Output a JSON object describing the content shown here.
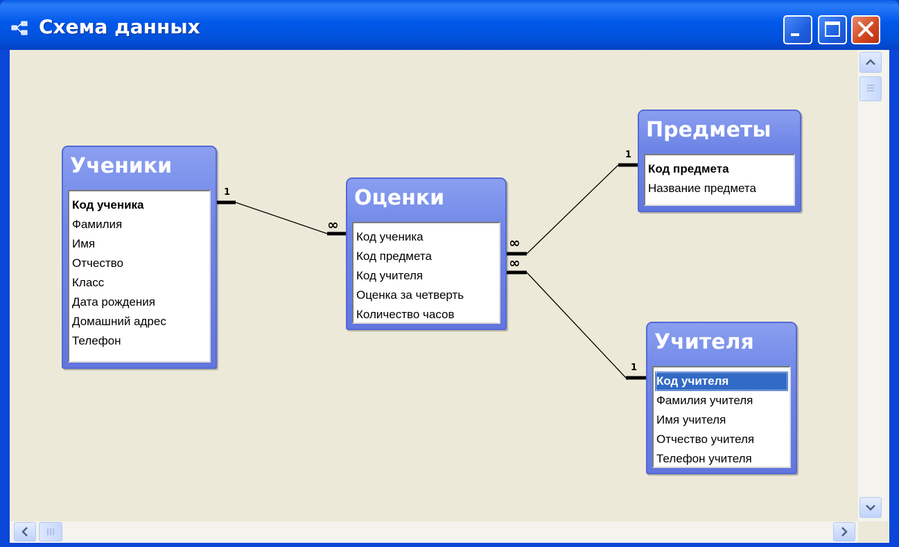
{
  "window": {
    "title": "Схема данных"
  },
  "titlebar_buttons": {
    "minimize": "minimize-icon",
    "maximize": "maximize-icon",
    "close": "close-icon"
  },
  "tables": {
    "students": {
      "title": "Ученики",
      "fields": [
        "Код ученика",
        "Фамилия",
        "Имя",
        "Отчество",
        "Класс",
        "Дата рождения",
        "Домашний адрес",
        "Телефон"
      ],
      "key": "Код ученика"
    },
    "grades": {
      "title": "Оценки",
      "fields": [
        "Код ученика",
        "Код предмета",
        "Код учителя",
        "Оценка за четверть",
        "Количество часов"
      ]
    },
    "subjects": {
      "title": "Предметы",
      "fields": [
        "Код предмета",
        "Название предмета"
      ],
      "key": "Код предмета"
    },
    "teachers": {
      "title": "Учителя",
      "fields": [
        "Код учителя",
        "Фамилия учителя",
        "Имя учителя",
        "Отчество учителя",
        "Телефон учителя"
      ],
      "key": "Код учителя",
      "selected": "Код учителя"
    }
  },
  "relations": {
    "one": "1",
    "many": "∞"
  },
  "colors": {
    "titlebar": "#0058ea",
    "canvas": "#ece9d8",
    "table_header": "#6f86e6",
    "selection": "#316ac5"
  }
}
